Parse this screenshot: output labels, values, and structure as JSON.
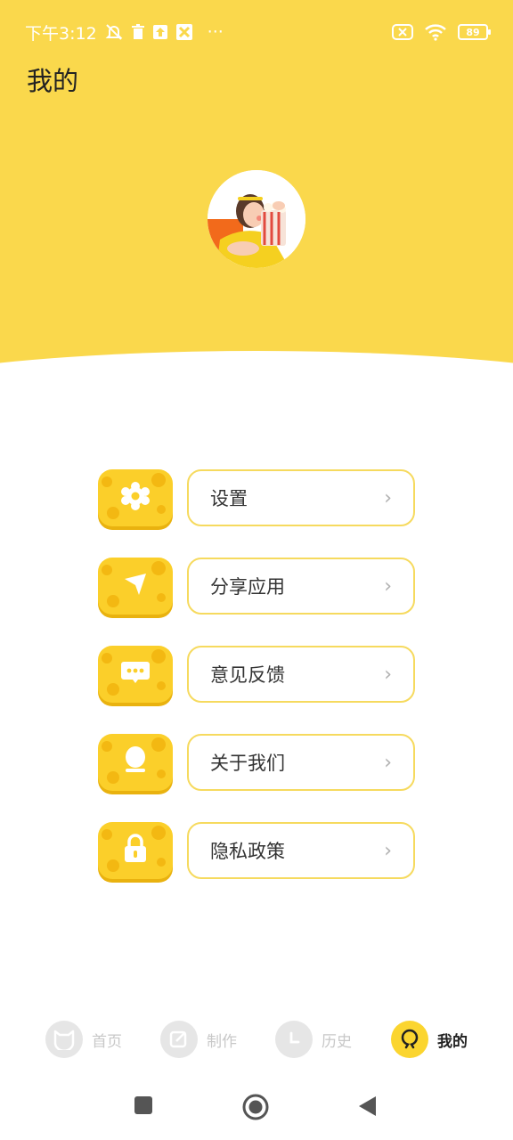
{
  "status_bar": {
    "time": "下午3:12",
    "more": "···",
    "battery": "89"
  },
  "header": {
    "title": "我的"
  },
  "menu": {
    "items": [
      {
        "label": "设置",
        "icon": "gear-icon",
        "chevron": "›"
      },
      {
        "label": "分享应用",
        "icon": "send-icon",
        "chevron": "›"
      },
      {
        "label": "意见反馈",
        "icon": "chat-icon",
        "chevron": "›"
      },
      {
        "label": "关于我们",
        "icon": "user-icon",
        "chevron": "›"
      },
      {
        "label": "隐私政策",
        "icon": "lock-icon",
        "chevron": "›"
      }
    ]
  },
  "bottom_nav": {
    "items": [
      {
        "label": "首页",
        "icon": "cat-icon",
        "active": false
      },
      {
        "label": "制作",
        "icon": "edit-icon",
        "active": false
      },
      {
        "label": "历史",
        "icon": "clock-icon",
        "active": false
      },
      {
        "label": "我的",
        "icon": "profile-icon",
        "active": true
      }
    ]
  },
  "colors": {
    "accent": "#FAD84C",
    "icon_tile": "#FBCF2A",
    "border": "#F6DA5E"
  }
}
